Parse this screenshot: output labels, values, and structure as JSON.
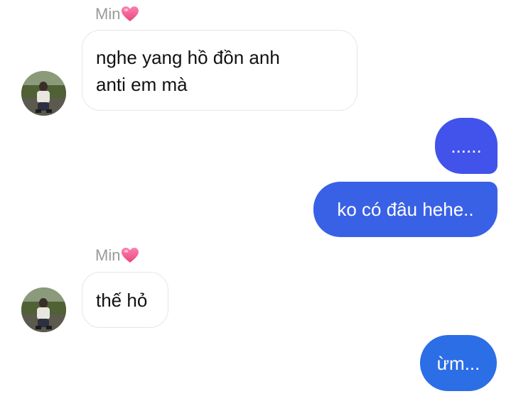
{
  "conversation": {
    "groups": [
      {
        "sender": "Min",
        "icon": "pink-heart-icon",
        "messages": [
          "nghe yang hồ đồn anh\nanti em mà"
        ]
      },
      {
        "sender": "me",
        "messages": [
          "......",
          "ko có đâu hehe.."
        ]
      },
      {
        "sender": "Min",
        "icon": "pink-heart-icon",
        "messages": [
          "thế hỏ"
        ]
      },
      {
        "sender": "me",
        "messages": [
          "ừm..."
        ]
      }
    ]
  },
  "colors": {
    "outgoing_top": "#4153ea",
    "outgoing_middle": "#3961e6",
    "outgoing_bottom": "#2c6ee6",
    "incoming_border": "#e6e6e6",
    "sender_name": "#9a9a9a",
    "heart": "#ef5a92"
  }
}
